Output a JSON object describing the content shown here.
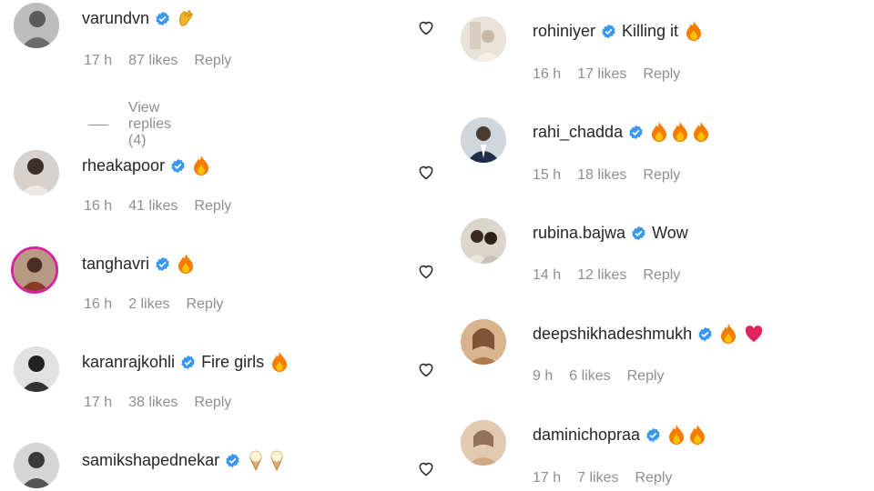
{
  "colors": {
    "text": "#262626",
    "muted": "#8e8e8e",
    "verified": "#3897f0",
    "fire": "#f57c00",
    "heart_red": "#e0245e"
  },
  "comments": [
    {
      "username": "varundvn",
      "text": "",
      "emoji": [
        "clap"
      ],
      "time": "17 h",
      "likes": "87 likes",
      "reply": "Reply",
      "verified": true,
      "view_replies": "View replies (4)"
    },
    {
      "username": "rheakapoor",
      "text": "",
      "emoji": [
        "fire"
      ],
      "time": "16 h",
      "likes": "41 likes",
      "reply": "Reply",
      "verified": true
    },
    {
      "username": "tanghavri",
      "text": "",
      "emoji": [
        "fire"
      ],
      "time": "16 h",
      "likes": "2 likes",
      "reply": "Reply",
      "verified": true
    },
    {
      "username": "karanrajkohli",
      "text": "Fire girls",
      "emoji": [
        "fire"
      ],
      "time": "17 h",
      "likes": "38 likes",
      "reply": "Reply",
      "verified": true
    },
    {
      "username": "samikshapednekar",
      "text": "",
      "emoji": [
        "ice-cream",
        "ice-cream"
      ],
      "verified": true
    },
    {
      "username": "rohiniyer",
      "text": "Killing it",
      "emoji": [
        "fire"
      ],
      "time": "16 h",
      "likes": "17 likes",
      "reply": "Reply",
      "verified": true
    },
    {
      "username": "rahi_chadda",
      "text": "",
      "emoji": [
        "fire",
        "fire",
        "fire"
      ],
      "time": "15 h",
      "likes": "18 likes",
      "reply": "Reply",
      "verified": true
    },
    {
      "username": "rubina.bajwa",
      "text": "Wow",
      "emoji": [],
      "time": "14 h",
      "likes": "12 likes",
      "reply": "Reply",
      "verified": true
    },
    {
      "username": "deepshikhadeshmukh",
      "text": "",
      "emoji": [
        "fire",
        "red-heart"
      ],
      "time": "9 h",
      "likes": "6 likes",
      "reply": "Reply",
      "verified": true
    },
    {
      "username": "daminichopraa",
      "text": "",
      "emoji": [
        "fire",
        "fire"
      ],
      "time": "17 h",
      "likes": "7 likes",
      "reply": "Reply",
      "verified": true
    }
  ]
}
